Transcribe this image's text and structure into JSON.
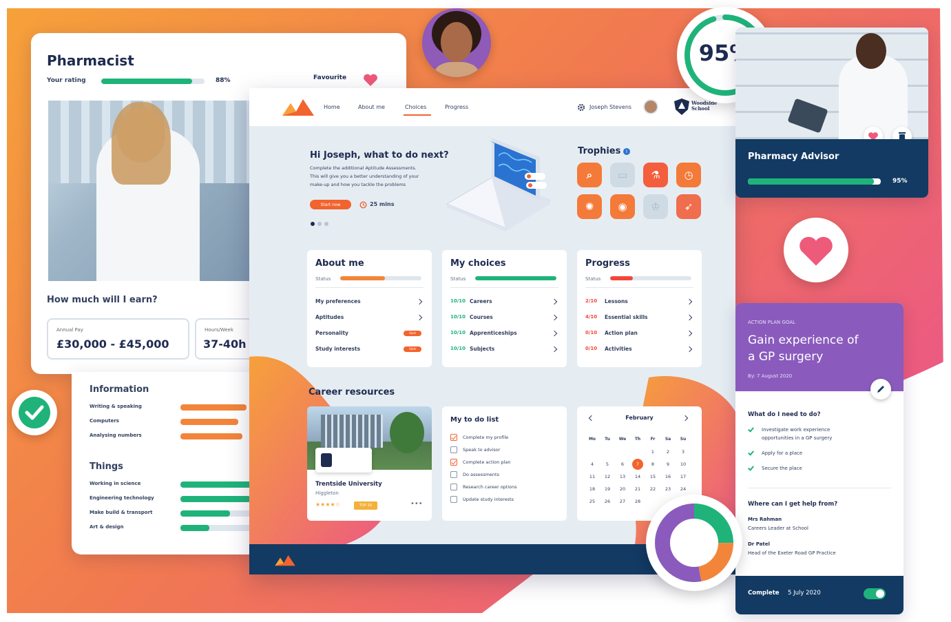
{
  "colors": {
    "orange": "#f3853a",
    "pink": "#ee5a7a",
    "purple": "#8a5bbd",
    "green": "#1fb37a",
    "navy": "#123a63",
    "light_bg": "#e5edf3"
  },
  "pharmacist": {
    "title": "Pharmacist",
    "rating_label": "Your rating",
    "rating_value": "88%",
    "rating_fraction": 0.88,
    "favourite_label": "Favourite",
    "heart_icon": "heart-icon",
    "earn_title": "How much will I earn?",
    "pay_label": "Annual Pay",
    "pay_value": "£30,000 - £45,000",
    "hours_label": "Hours/Week",
    "hours_value": "37-40h"
  },
  "info": {
    "title": "Information",
    "items": [
      {
        "label": "Writing & speaking",
        "level": 0.8
      },
      {
        "label": "Computers",
        "level": 0.7
      },
      {
        "label": "Analysing numbers",
        "level": 0.75
      }
    ],
    "things_title": "Things",
    "things": [
      {
        "label": "Working in science",
        "level": 0.9
      },
      {
        "label": "Engineering technology",
        "level": 0.85
      },
      {
        "label": "Make build & transport",
        "level": 0.6
      },
      {
        "label": "Art & design",
        "level": 0.35
      }
    ]
  },
  "score_badge": {
    "value": "95%",
    "fraction": 0.95
  },
  "advisor": {
    "title": "Pharmacy Advisor",
    "value": "95%",
    "fraction": 0.95
  },
  "app": {
    "nav": [
      "Home",
      "About me",
      "Choices",
      "Progress"
    ],
    "active_nav": "Choices",
    "user_name": "Joseph Stevens",
    "school_name": "Woodside School",
    "hero_title": "Hi Joseph, what to do next?",
    "hero_body": [
      "Complete the additional Aptitude Assessments.",
      "This will give you a better understanding of your",
      "make-up and how you tackle the problems"
    ],
    "start_label": "Start now",
    "time_label": "25 mins",
    "trophies_title": "Trophies",
    "about": {
      "title": "About me",
      "status_label": "Status",
      "progress": 0.55,
      "items": [
        {
          "label": "My preferences",
          "action": "chevron"
        },
        {
          "label": "Aptitudes",
          "action": "chevron"
        },
        {
          "label": "Personality",
          "action": "Start"
        },
        {
          "label": "Study interests",
          "action": "Start"
        }
      ]
    },
    "choices": {
      "title": "My choices",
      "status_label": "Status",
      "progress": 1.0,
      "items": [
        {
          "fraction": "10/10",
          "label": "Careers"
        },
        {
          "fraction": "10/10",
          "label": "Courses"
        },
        {
          "fraction": "10/10",
          "label": "Apprenticeships"
        },
        {
          "fraction": "10/10",
          "label": "Subjects"
        }
      ]
    },
    "progress": {
      "title": "Progress",
      "status_label": "Status",
      "progress": 0.28,
      "items": [
        {
          "fraction": "2/10",
          "label": "Lessons"
        },
        {
          "fraction": "4/10",
          "label": "Essential skills"
        },
        {
          "fraction": "0/10",
          "label": "Action plan"
        },
        {
          "fraction": "0/10",
          "label": "Activities"
        }
      ]
    },
    "resources_title": "Career resources",
    "uni": {
      "name": "Trentside University",
      "sub": "Higgleton",
      "badge": "TOP 10"
    },
    "todo": {
      "title": "My to do list",
      "items": [
        {
          "label": "Complete my profile",
          "checked": true
        },
        {
          "label": "Speak to advisor",
          "checked": false
        },
        {
          "label": "Complete action plan",
          "checked": true
        },
        {
          "label": "Do assessments",
          "checked": false
        },
        {
          "label": "Research career options",
          "checked": false
        },
        {
          "label": "Update study interests",
          "checked": false
        }
      ]
    },
    "calendar": {
      "month": "February",
      "weekdays": [
        "Mo",
        "Tu",
        "We",
        "Th",
        "Fr",
        "Sa",
        "Su"
      ],
      "weeks": [
        [
          "",
          "",
          "",
          "",
          "1",
          "2",
          "3"
        ],
        [
          "4",
          "5",
          "6",
          "7",
          "8",
          "9",
          "10"
        ],
        [
          "11",
          "12",
          "13",
          "14",
          "15",
          "16",
          "17"
        ],
        [
          "18",
          "19",
          "20",
          "21",
          "22",
          "23",
          "24"
        ],
        [
          "25",
          "26",
          "27",
          "28",
          "",
          "",
          ""
        ]
      ],
      "selected": "7"
    }
  },
  "donut": {
    "segments": [
      {
        "color": "#1fb37a",
        "fraction": 0.25
      },
      {
        "color": "#f3853a",
        "fraction": 0.22
      },
      {
        "color": "#8a5bbd",
        "fraction": 0.53
      }
    ]
  },
  "plan": {
    "kicker": "ACTION PLAN GOAL",
    "title": [
      "Gain experience of",
      "a GP surgery"
    ],
    "by": "By: 7 August 2020",
    "q1": "What do I need to do?",
    "tasks": [
      [
        "Investigate work experience",
        "opportunities in a GP surgery"
      ],
      [
        "Apply for a place"
      ],
      [
        "Secure the place"
      ]
    ],
    "q2": "Where can I get help from?",
    "helpers": [
      {
        "name": "Mrs Rahman",
        "role": "Careers Leader at School"
      },
      {
        "name": "Dr Patel",
        "role": "Head of the Exeter Road GP Practice"
      }
    ],
    "complete_label": "Complete",
    "complete_date": "5 July 2020"
  }
}
